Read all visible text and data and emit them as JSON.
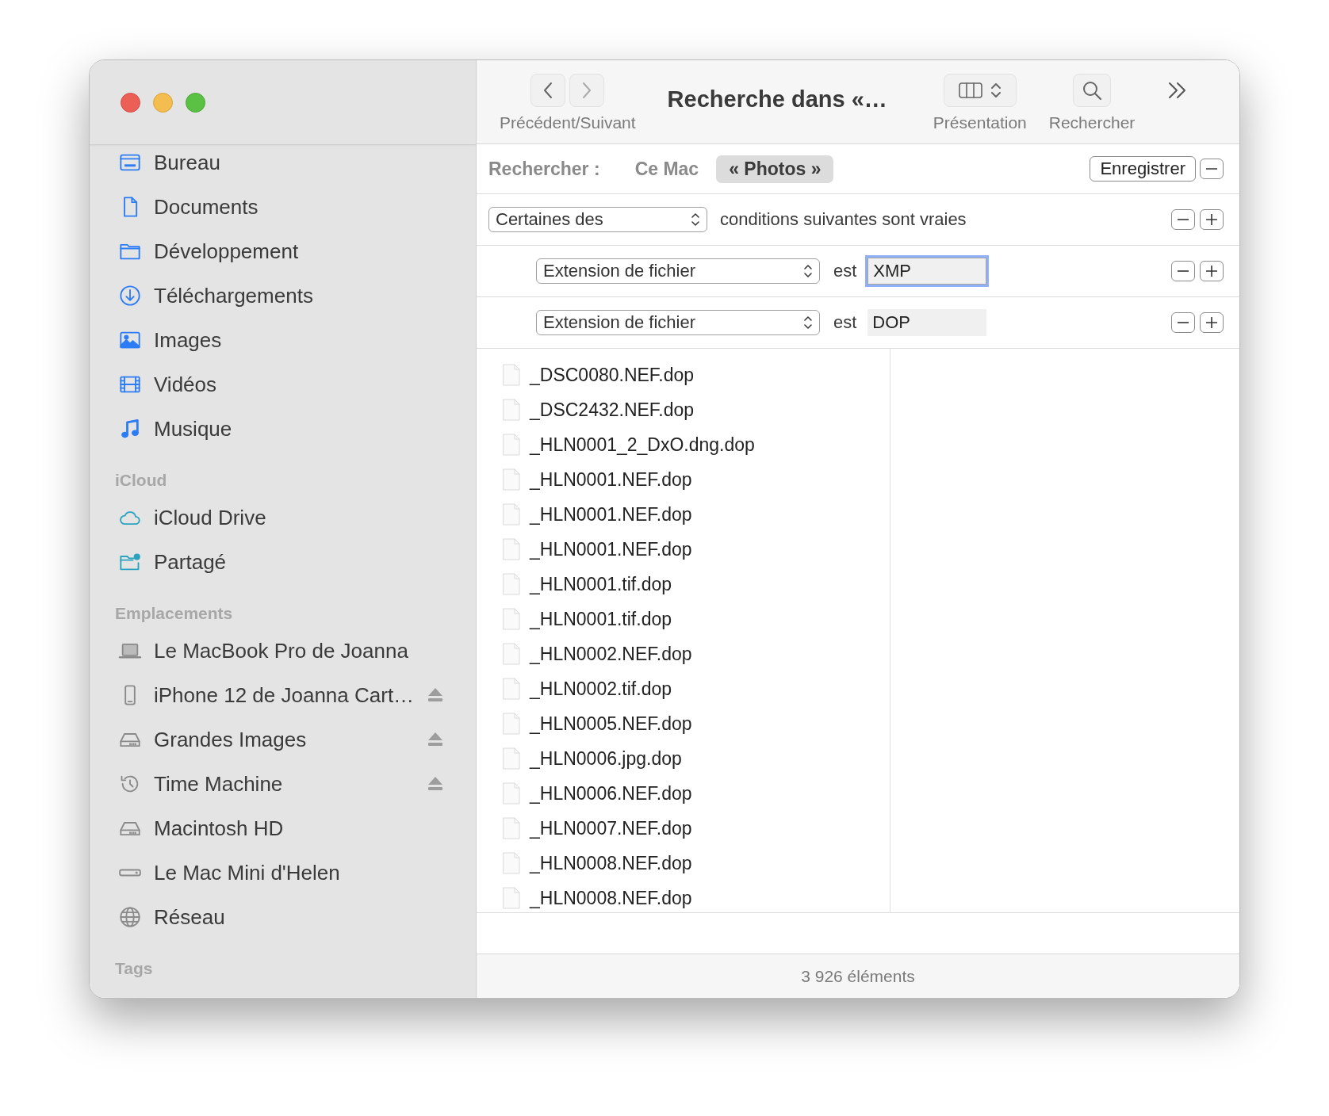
{
  "window": {
    "title": "Recherche dans «…"
  },
  "toolbar": {
    "nav_label": "Précédent/Suivant",
    "view_label": "Présentation",
    "search_label": "Rechercher"
  },
  "sidebar": {
    "sections": [
      {
        "items": [
          {
            "label": "Bureau"
          },
          {
            "label": "Documents"
          },
          {
            "label": "Développement"
          },
          {
            "label": "Téléchargements"
          },
          {
            "label": "Images"
          },
          {
            "label": "Vidéos"
          },
          {
            "label": "Musique"
          }
        ]
      },
      {
        "header": "iCloud",
        "items": [
          {
            "label": "iCloud Drive"
          },
          {
            "label": "Partagé"
          }
        ]
      },
      {
        "header": "Emplacements",
        "items": [
          {
            "label": "Le MacBook Pro de Joanna",
            "ejectable": false
          },
          {
            "label": "iPhone 12 de Joanna Cart…",
            "ejectable": true
          },
          {
            "label": "Grandes Images",
            "ejectable": true
          },
          {
            "label": "Time Machine",
            "ejectable": true
          },
          {
            "label": "Macintosh HD",
            "ejectable": false
          },
          {
            "label": "Le Mac Mini d'Helen",
            "ejectable": false
          },
          {
            "label": "Réseau",
            "ejectable": false
          }
        ]
      },
      {
        "header": "Tags"
      }
    ]
  },
  "scope_bar": {
    "label": "Rechercher :",
    "scopes": [
      {
        "label": "Ce Mac",
        "selected": false
      },
      {
        "label": "« Photos »",
        "selected": true
      }
    ],
    "save_button": "Enregistrer"
  },
  "criteria": {
    "match": "Certaines des",
    "match_suffix": "conditions suivantes sont vraies",
    "rules": [
      {
        "attribute": "Extension de fichier",
        "operator": "est",
        "value": "XMP",
        "focused": true
      },
      {
        "attribute": "Extension de fichier",
        "operator": "est",
        "value": "DOP",
        "focused": false
      }
    ]
  },
  "files": [
    "_DSC0080.NEF.dop",
    "_DSC2432.NEF.dop",
    "_HLN0001_2_DxO.dng.dop",
    "_HLN0001.NEF.dop",
    "_HLN0001.NEF.dop",
    "_HLN0001.NEF.dop",
    "_HLN0001.tif.dop",
    "_HLN0001.tif.dop",
    "_HLN0002.NEF.dop",
    "_HLN0002.tif.dop",
    "_HLN0005.NEF.dop",
    "_HLN0006.jpg.dop",
    "_HLN0006.NEF.dop",
    "_HLN0007.NEF.dop",
    "_HLN0008.NEF.dop",
    "_HLN0008.NEF.dop"
  ],
  "status_bar": "3 926 éléments"
}
